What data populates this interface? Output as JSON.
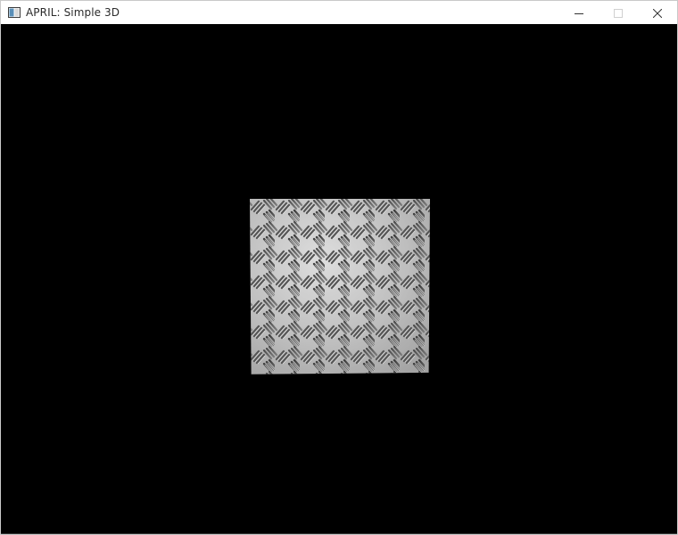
{
  "window": {
    "title": "APRIL: Simple 3D",
    "controls": {
      "minimize_icon": "minimize-icon",
      "maximize_icon": "maximize-icon",
      "close_icon": "close-icon"
    },
    "maximize_enabled": false
  },
  "viewport": {
    "background_color": "#000000",
    "object": {
      "type": "textured-quad",
      "texture": "diamond-plate-metal"
    }
  },
  "colors": {
    "titlebar": "#ffffff",
    "title_text": "#2b2b2b",
    "metal_light": "#c9c9c9",
    "metal_groove": "#4a4a4a"
  }
}
